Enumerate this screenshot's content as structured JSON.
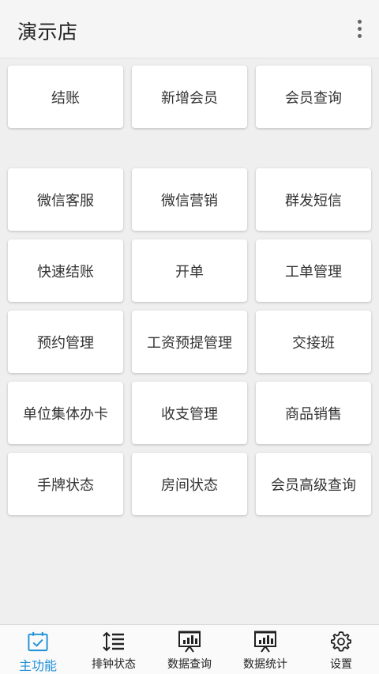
{
  "header": {
    "title": "演示店",
    "more_icon": "more-vertical-icon"
  },
  "top_actions": [
    "结账",
    "新增会员",
    "会员查询"
  ],
  "main_actions": [
    "微信客服",
    "微信营销",
    "群发短信",
    "快速结账",
    "开单",
    "工单管理",
    "预约管理",
    "工资预提管理",
    "交接班",
    "单位集体办卡",
    "收支管理",
    "商品销售",
    "手牌状态",
    "房间状态",
    "会员高级查询"
  ],
  "bottom_nav": [
    {
      "label": "主功能",
      "icon": "calendar-check-icon",
      "active": true
    },
    {
      "label": "排钟状态",
      "icon": "sort-list-icon",
      "active": false
    },
    {
      "label": "数据查询",
      "icon": "presentation-chart-icon",
      "active": false
    },
    {
      "label": "数据统计",
      "icon": "presentation-chart-icon",
      "active": false
    },
    {
      "label": "设置",
      "icon": "gear-icon",
      "active": false
    }
  ],
  "colors": {
    "accent": "#1e90d8",
    "background": "#efefef",
    "card": "#ffffff"
  }
}
